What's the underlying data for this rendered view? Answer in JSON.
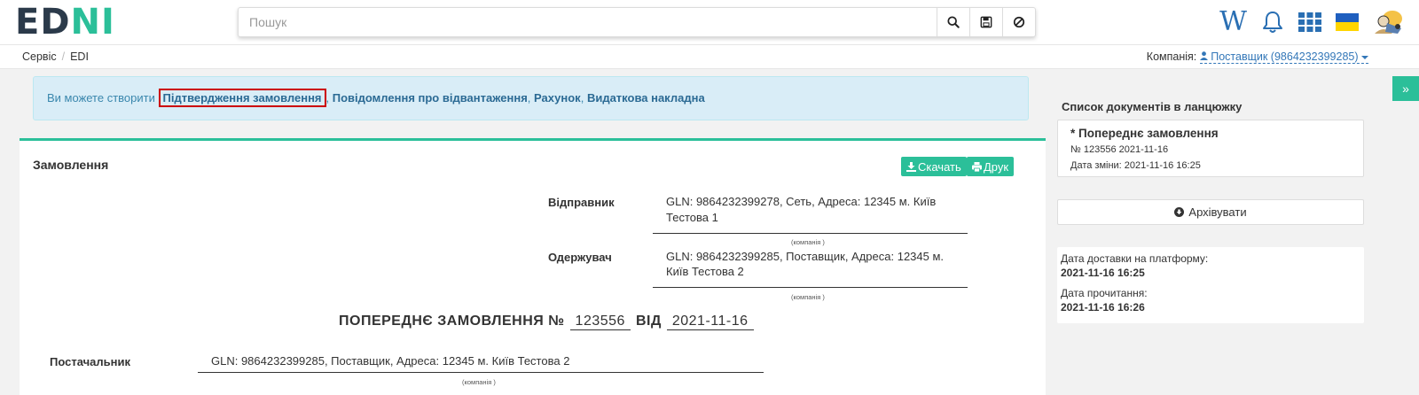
{
  "header": {
    "logo": {
      "part1": "ED",
      "part2": "N",
      "part3": "I"
    },
    "search": {
      "placeholder": "Пошук"
    },
    "icons": {
      "search": "search-icon",
      "save": "floppy-disk-icon",
      "clear": "ban-icon",
      "wiki": "W",
      "bell": "bell-icon",
      "apps": "grid-icon",
      "flag": "ukraine-flag-icon",
      "avatar": "user-avatar"
    }
  },
  "breadcrumb": {
    "items": [
      "Сервіс",
      "EDI"
    ]
  },
  "company": {
    "label": "Компанія:",
    "value": "Поставщик (9864232399285)"
  },
  "alert": {
    "prefix": "Ви можете створити",
    "links": [
      "Підтвердження замовлення",
      "Повідомлення про відвантаження",
      "Рахунок",
      "Видаткова накладна"
    ],
    "separator": ","
  },
  "document": {
    "title": "Замовлення",
    "download_label": "Скачать",
    "print_label": "Друк",
    "sender": {
      "label": "Відправник",
      "line1": "GLN: 9864232399278, Сеть, Адреса: 12345 м. Київ",
      "line2": "Тестова 1",
      "caption": "(компанія )"
    },
    "recipient": {
      "label": "Одержувач",
      "line1": "GLN: 9864232399285, Поставщик, Адреса: 12345 м.",
      "line2": "Київ Тестова 2",
      "caption": "(компанія )"
    },
    "heading": {
      "prefix": "ПОПЕРЕДНЄ ЗАМОВЛЕННЯ №",
      "number": "123556",
      "from": "ВІД",
      "date": "2021-11-16"
    },
    "supplier": {
      "label": "Постачальник",
      "value": "GLN: 9864232399285, Поставщик, Адреса: 12345 м. Київ Тестова 2",
      "caption": "(компанія )"
    }
  },
  "right_panel": {
    "chain_title": "Список документів в ланцюжку",
    "chain_item": {
      "title": "* Попереднє замовлення",
      "number_date": "№ 123556 2021-11-16",
      "changed": "Дата зміни: 2021-11-16 16:25"
    },
    "archive_label": "Архівувати",
    "delivery_label": "Дата доставки на платформу:",
    "delivery_value": "2021-11-16 16:25",
    "read_label": "Дата прочитання:",
    "read_value": "2021-11-16 16:26"
  },
  "colors": {
    "accent": "#2bbf99",
    "link": "#3377b8",
    "alert_bg": "#d9edf7",
    "highlight": "#cc0000"
  }
}
